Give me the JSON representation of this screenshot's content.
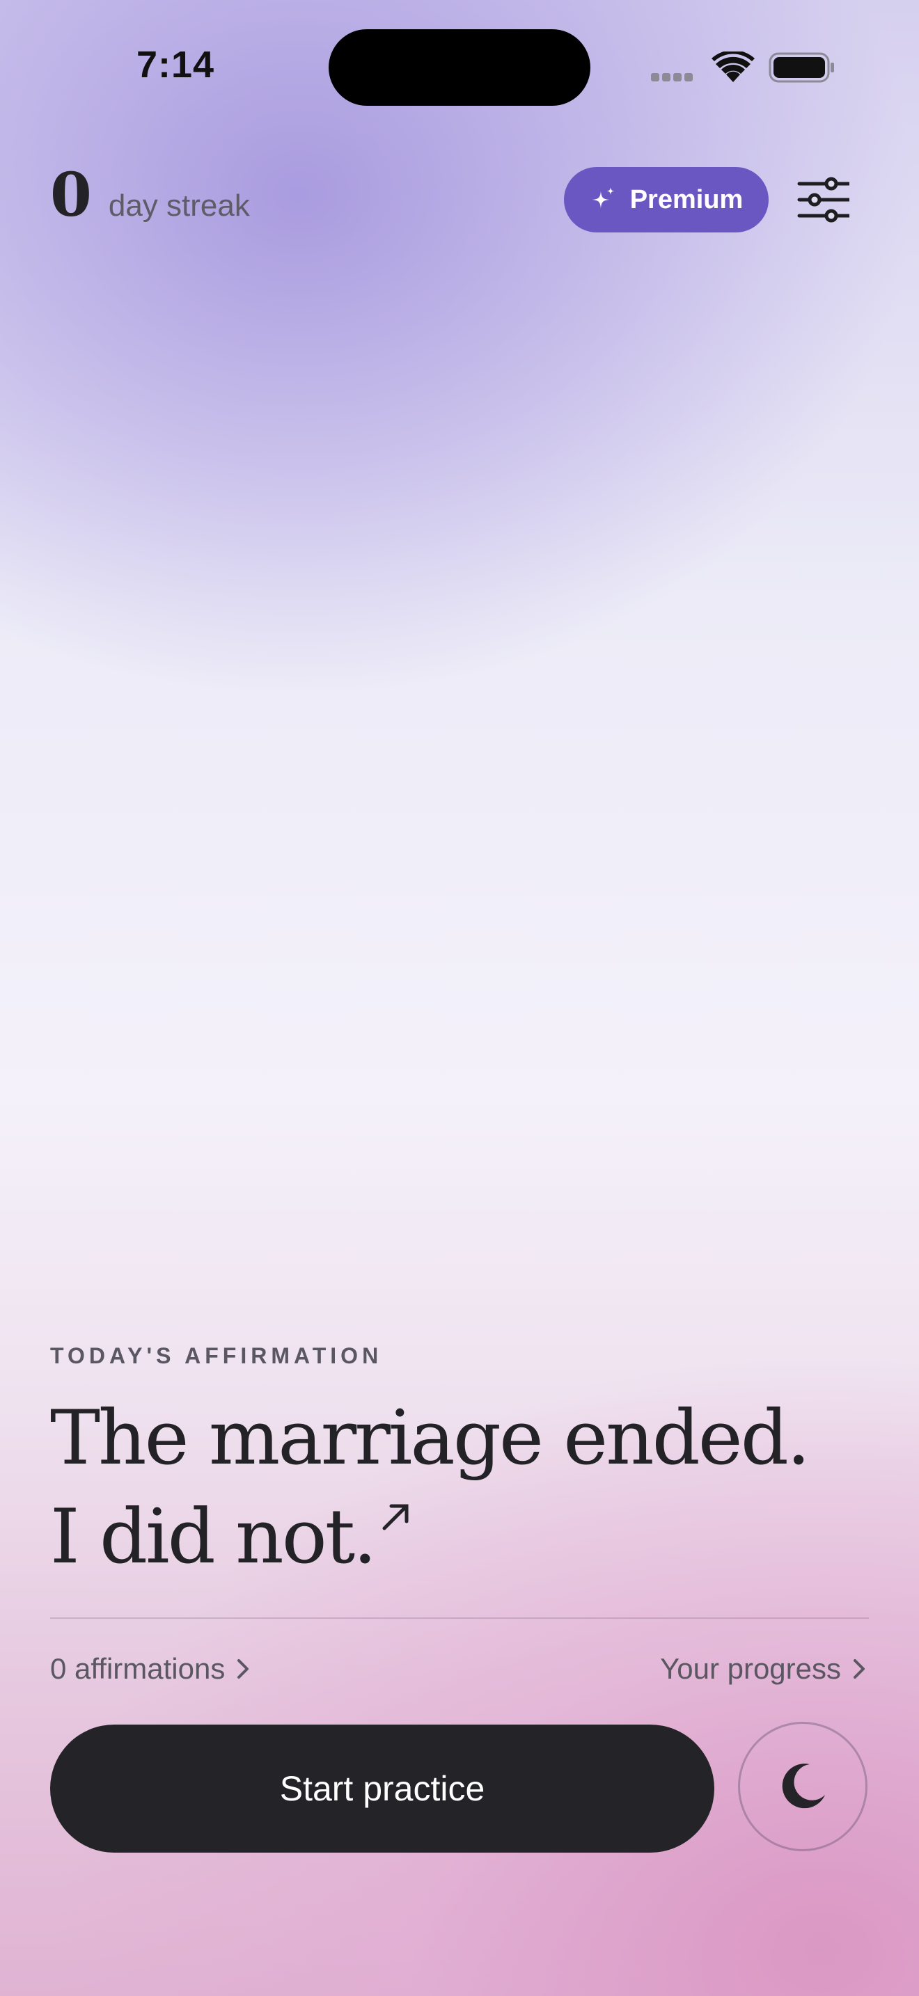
{
  "status_bar": {
    "time": "7:14"
  },
  "header": {
    "streak_count": "0",
    "streak_label": "day streak",
    "premium_label": "Premium"
  },
  "affirmation": {
    "eyebrow": "TODAY'S AFFIRMATION",
    "text": "The marriage ended. I did not."
  },
  "links": {
    "affirmations": "0 affirmations",
    "progress": "Your progress"
  },
  "actions": {
    "start_label": "Start practice"
  },
  "icons": {
    "premium": "sparkle-icon",
    "settings": "sliders-icon",
    "open": "arrow-up-right-icon",
    "links": "chevron-right-icon",
    "night": "moon-icon",
    "wifi": "wifi-icon",
    "battery": "battery-icon"
  },
  "colors": {
    "accent": "#6b57c2",
    "primary_button": "#242328",
    "text": "#232227",
    "muted_text": "#5a5762"
  }
}
